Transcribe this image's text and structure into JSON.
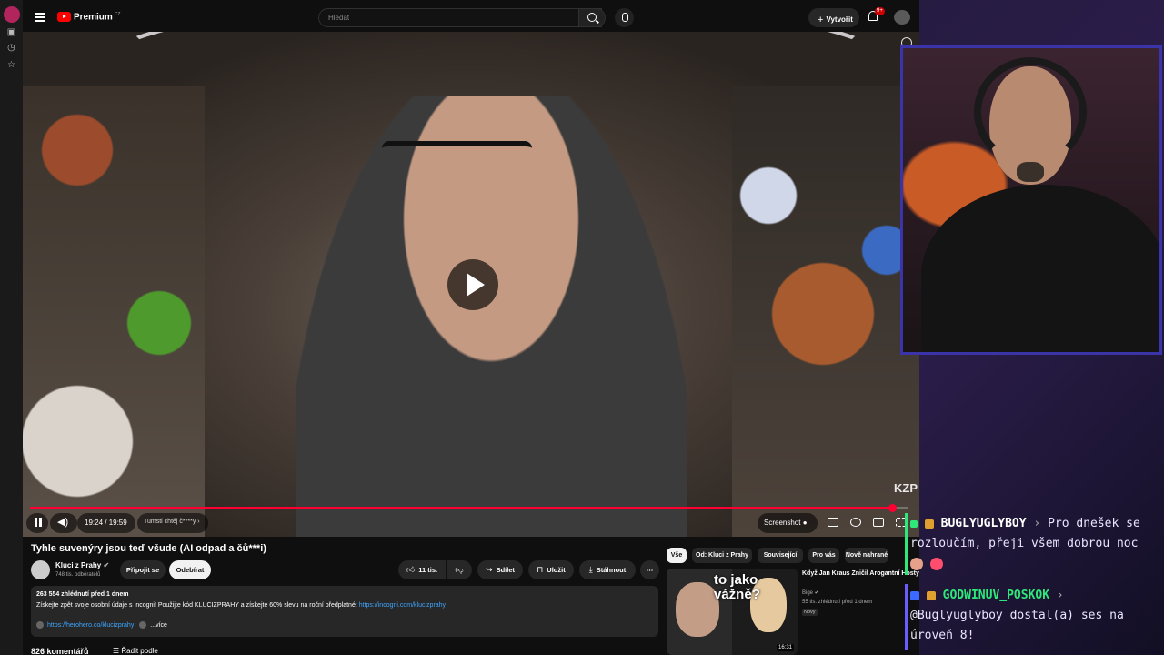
{
  "youtube": {
    "brand": "Premium",
    "brand_country": "CZ",
    "search_placeholder": "Hledat",
    "create_label": "Vytvořit",
    "notification_count": "9+",
    "video": {
      "title": "Tyhle suvenýry jsou teď všude (AI odpad a čů***i)",
      "progress_fraction": 0.9815,
      "time": "19:24 / 19:59",
      "chapter": "Tumsti chtěj č****y",
      "screenshot_label": "Screenshot",
      "watermark": "KZP"
    },
    "channel": {
      "name": "Kluci z Prahy",
      "subscribers": "748 tis. odběratelů",
      "join_label": "Připojit se",
      "subscribe_label": "Odebírat"
    },
    "actions": {
      "likes": "11 tis.",
      "share": "Sdílet",
      "save": "Uložit",
      "download": "Stáhnout"
    },
    "description": {
      "stats": "263 554 zhlédnutí  před 1 dnem",
      "line": "Získejte zpět svoje osobní údaje s Incogni! Použijte kód KLUCIZPRAHY a získejte 60% slevu na roční předplatné: ",
      "link": "https://incogni.com/klucizprahy",
      "link2": "https://herohero.co/klucizprahy",
      "more": "...více"
    },
    "comments_count": "826 komentářů",
    "sort_label": "Řadit podle",
    "chips": [
      "Vše",
      "Od: Kluci z Prahy",
      "Související",
      "Pro vás",
      "Nově nahrané"
    ],
    "recommendation": {
      "title": "Když Jan Kraus Zničil Arogantní Hosty",
      "channel": "Bige",
      "meta": "55 tis. zhlédnutí  před 1 dnem",
      "badge": "Nový",
      "thumb_text": "to jako vážně?",
      "duration": "16:31"
    }
  },
  "chat": [
    {
      "user": "BUGLYUGLYBOY",
      "text": "Pro dnešek se rozloučím, přeji všem dobrou noc"
    },
    {
      "user": "GODWINUV_POSKOK",
      "text": "@Buglyuglyboy dostal(a) ses na úroveň 8!"
    }
  ]
}
